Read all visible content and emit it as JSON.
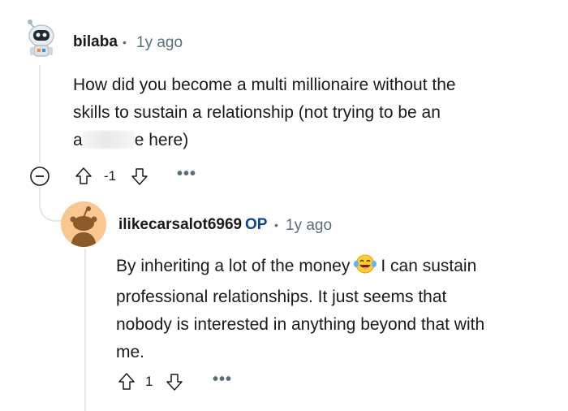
{
  "comments": [
    {
      "username": "bilaba",
      "time": "1y ago",
      "avatar_icon": "astronaut-robot-icon",
      "body": {
        "line1": "How did you become a multi millionaire without the",
        "line2": "skills to sustain a relationship (not trying to be an",
        "line3_start": "a",
        "line3_end": "e here)"
      },
      "score": "-1",
      "collapse_icon": "minus-circle-icon",
      "upvote_icon": "upvote-arrow-icon",
      "downvote_icon": "downvote-arrow-icon",
      "more": "•••"
    },
    {
      "username": "ilikecarsalot6969",
      "flair": "OP",
      "time": "1y ago",
      "avatar_icon": "default-snoo-avatar-icon",
      "body": {
        "line1_start": "By inheriting a lot of the money",
        "line1_end": "I can sustain",
        "line2": "professional relationships. It just seems that",
        "line3": "nobody is interested in anything beyond that with",
        "line4": "me."
      },
      "emoji": "laughing-tears-emoji",
      "score": "1",
      "upvote_icon": "upvote-arrow-icon",
      "downvote_icon": "downvote-arrow-icon",
      "more": "•••"
    }
  ],
  "separator": "•",
  "colors": {
    "op_blue": "#0a449b",
    "meta_gray": "#576f76",
    "thread_line": "#e5e7e9",
    "reply_avatar_bg": "#fbc791"
  }
}
